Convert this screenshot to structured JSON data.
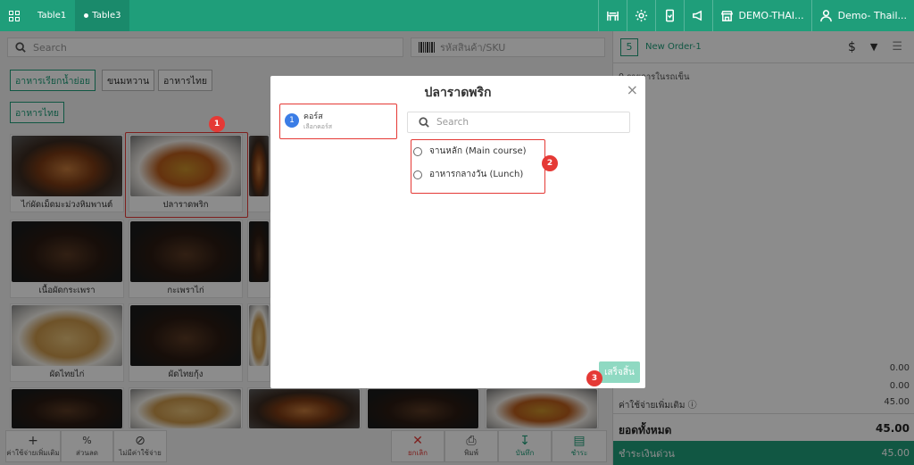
{
  "topbar": {
    "tabs": [
      {
        "label": "Table1"
      },
      {
        "label": "Table3"
      }
    ],
    "branch": "DEMO-THAI...",
    "user": "Demo- Thail..."
  },
  "search": {
    "placeholder": "Search",
    "sku_placeholder": "รหัสสินค้า/SKU"
  },
  "categories": [
    "อาหารเรียกน้ำย่อย",
    "ขนมหวาน",
    "อาหารไทย",
    "อาหารไทย"
  ],
  "products": [
    {
      "name": "ไก่ผัดเม็ดมะม่วงหิมพานต์"
    },
    {
      "name": "ปลาราดพริก"
    },
    {
      "name": "เนื้อผัดกระเพรา"
    },
    {
      "name": "กะเพราไก่"
    },
    {
      "name": "ผัดไทยไก่"
    },
    {
      "name": "ผัดไทยกุ้ง"
    }
  ],
  "actions": {
    "extra_charge": "ค่าใช้จ่ายเพิ่มเติม",
    "discount": "ส่วนลด",
    "no_charge": "ไม่มีค่าใช้จ่าย",
    "cancel": "ยกเลิก",
    "print": "พิมพ์",
    "save": "บันทึก",
    "pay": "ชำระ",
    "discount_symbol": "%"
  },
  "order": {
    "number": "5",
    "name": "New Order-1",
    "items_label": "0 รายการในรถเข็น",
    "subtotal_1": "0.00",
    "subtotal_2": "0.00",
    "extra_label": "ค่าใช้จ่ายเพิ่มเติม",
    "extra_value": "45.00",
    "total_label": "ยอดทั้งหมด",
    "total_value": "45.00",
    "pay_label": "ชำระเงินด่วน",
    "pay_value": "45.00",
    "currency_symbol": "$"
  },
  "modal": {
    "title": "ปลาราดพริก",
    "close": "×",
    "step_number": "1",
    "step_title": "คอร์ส",
    "step_subtitle": "เลือกคอร์ส",
    "search_placeholder": "Search",
    "options": [
      {
        "label": "จานหลัก (Main course)"
      },
      {
        "label": "อาหารกลางวัน (Lunch)"
      }
    ],
    "finish": "เสร็จสิ้น"
  },
  "badges": [
    "1",
    "2",
    "3"
  ],
  "colors": {
    "accent": "#1f9e7a",
    "highlight": "#e53935",
    "step": "#3b7de6"
  }
}
